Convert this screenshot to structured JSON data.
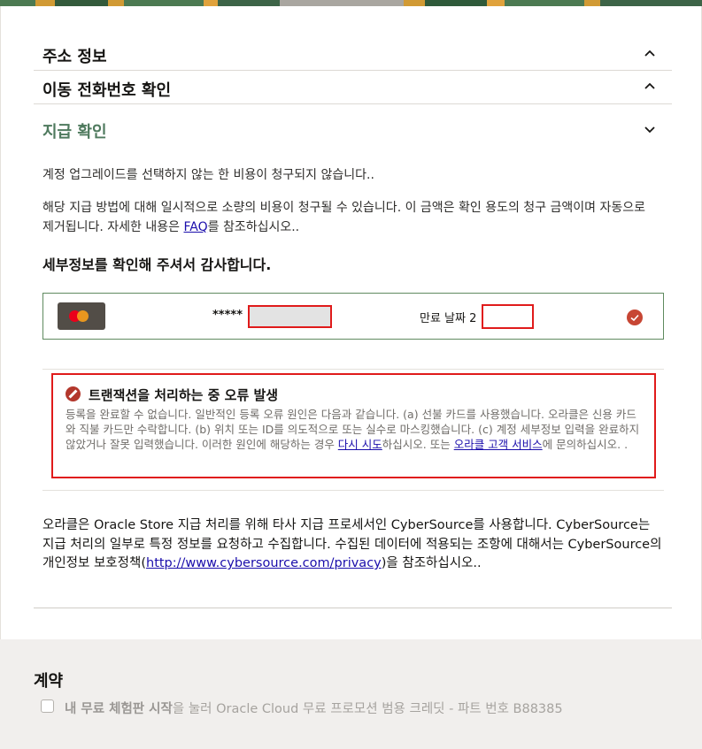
{
  "sections": {
    "address": {
      "title": "주소 정보"
    },
    "mobile": {
      "title": "이동 전화번호 확인"
    },
    "payment": {
      "title": "지급 확인"
    }
  },
  "notice1": "계정 업그레이드를 선택하지 않는 한 비용이 청구되지 않습니다..",
  "notice2_before": "해당 지급 방법에 대해 일시적으로 소량의 비용이 청구될 수 있습니다. 이 금액은 확인 용도의 청구 금액이며 자동으로 제거됩니다. 자세한 내용은 ",
  "notice2_link": "FAQ",
  "notice2_after": "를 참조하십시오..",
  "confirm_heading": "세부정보를 확인해 주셔서 감사합니다.",
  "card": {
    "brand_icon": "mastercard-icon",
    "number_mask": "*****",
    "expiry_label": "만료 날짜 2",
    "status_icon": "check-circle-icon"
  },
  "error": {
    "title": "트랜잭션을 처리하는 중 오류 발생",
    "body_before": "등록을 완료할 수 없습니다. 일반적인 등록 오류 원인은 다음과 같습니다. (a) 선불 카드를 사용했습니다. 오라클은 신용 카드와 직불 카드만 수락합니다. (b) 위치 또는 ID를 의도적으로 또는 실수로 마스킹했습니다. (c) 계정 세부정보 입력을 완료하지 않았거나 잘못 입력했습니다. 이러한 원인에 해당하는 경우 ",
    "retry_link": "다시 시도",
    "body_middle": "하십시오. 또는 ",
    "support_link": "오라클 고객 서비스",
    "body_after": "에 문의하십시오. ."
  },
  "cybersource": {
    "before": "오라클은 Oracle Store 지급 처리를 위해 타사 지급 프로세서인 CyberSource를 사용합니다. CyberSource는 지급 처리의 일부로 특정 정보를 요청하고 수집합니다. 수집된 데이터에 적용되는 조항에 대해서는 CyberSource의 개인정보 보호정책(",
    "link": "http://www.cybersource.com/privacy",
    "after": ")을 참조하십시오.."
  },
  "contract": {
    "title": "계약",
    "checkbox_bold": "내 무료 체험판 시작",
    "checkbox_rest": "을 눌러 Oracle Cloud 무료 프로모션 범용 크레딧 - 파트 번호 B88385"
  },
  "colors": {
    "accent_green": "#4f7a5e",
    "error_red": "#e01b1b",
    "brand_red": "#c74634"
  }
}
